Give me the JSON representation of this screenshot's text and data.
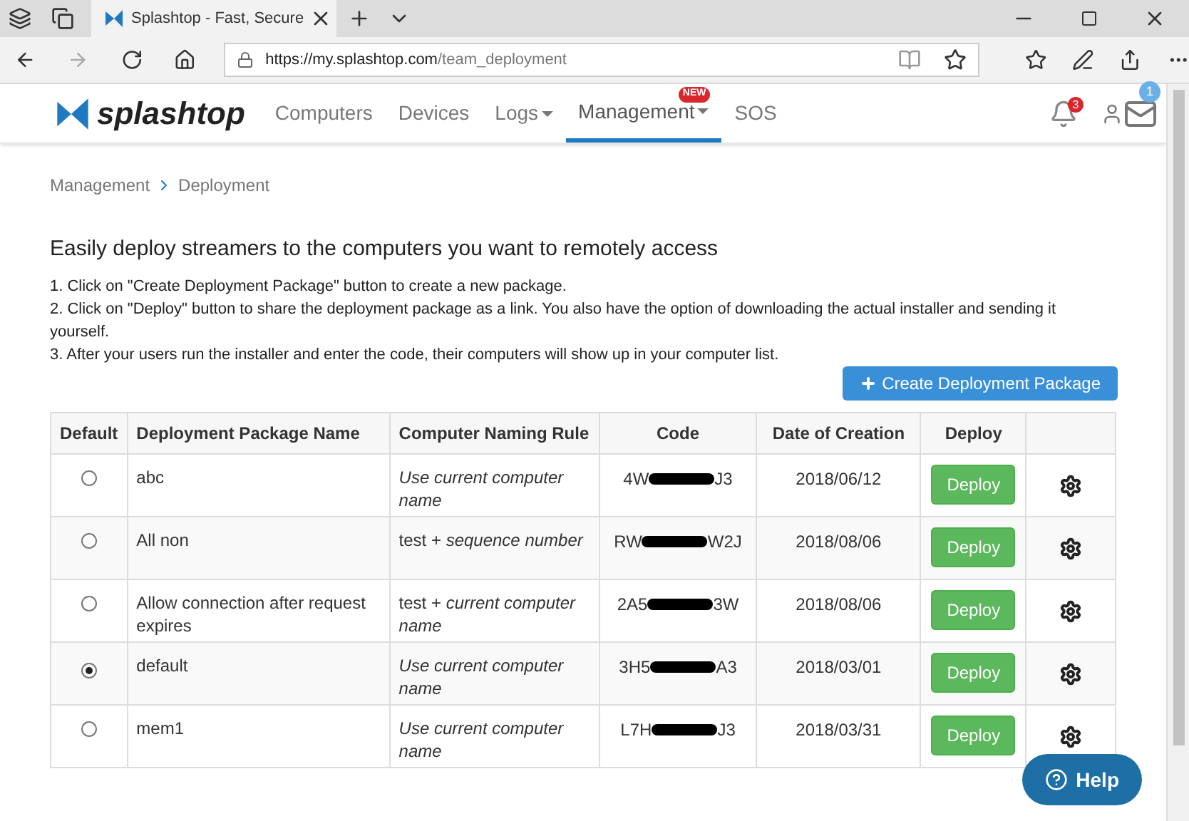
{
  "browser": {
    "tab_title": "Splashtop - Fast, Secure",
    "url_host": "https://my.splashtop.com",
    "url_path": "/team_deployment"
  },
  "nav": {
    "logo": "splashtop",
    "items": [
      {
        "label": "Computers",
        "selected": false,
        "dropdown": false
      },
      {
        "label": "Devices",
        "selected": false,
        "dropdown": false
      },
      {
        "label": "Logs",
        "selected": false,
        "dropdown": true
      },
      {
        "label": "Management",
        "selected": true,
        "dropdown": true,
        "badge": "NEW"
      },
      {
        "label": "SOS",
        "selected": false,
        "dropdown": false
      }
    ],
    "notifications_count": "3",
    "messages_count": "1"
  },
  "breadcrumb": [
    "Management",
    "Deployment"
  ],
  "heading": "Easily deploy streamers to the computers you want to remotely access",
  "steps": [
    "1. Click on \"Create Deployment Package\" button to create a new package.",
    "2. Click on \"Deploy\" button to share the deployment package as a link. You also have the option of downloading the actual installer and sending it yourself.",
    "3. After your users run the installer and enter the code, their computers will show up in your computer list."
  ],
  "create_button": "Create Deployment Package",
  "table": {
    "columns": [
      "Default",
      "Deployment Package Name",
      "Computer Naming Rule",
      "Code",
      "Date of Creation",
      "Deploy"
    ],
    "rows": [
      {
        "selected": false,
        "name": "abc",
        "rule_prefix": "",
        "rule": "Use current computer name",
        "code_start": "4W",
        "code_end": "J3",
        "date": "2018/06/12",
        "deploy": "Deploy"
      },
      {
        "selected": false,
        "name": "All non",
        "rule_prefix": "test +",
        "rule": "sequence number",
        "code_start": "RW",
        "code_end": "W2J",
        "date": "2018/08/06",
        "deploy": "Deploy"
      },
      {
        "selected": false,
        "name": "Allow connection after request expires",
        "rule_prefix": "test +",
        "rule": "current computer name",
        "code_start": "2A5",
        "code_end": "3W",
        "date": "2018/08/06",
        "deploy": "Deploy"
      },
      {
        "selected": true,
        "name": "default",
        "rule_prefix": "",
        "rule": "Use current computer name",
        "code_start": "3H5",
        "code_end": "A3",
        "date": "2018/03/01",
        "deploy": "Deploy"
      },
      {
        "selected": false,
        "name": "mem1",
        "rule_prefix": "",
        "rule": "Use current computer name",
        "code_start": "L7H",
        "code_end": "J3",
        "date": "2018/03/31",
        "deploy": "Deploy"
      }
    ]
  },
  "help_button": "Help"
}
